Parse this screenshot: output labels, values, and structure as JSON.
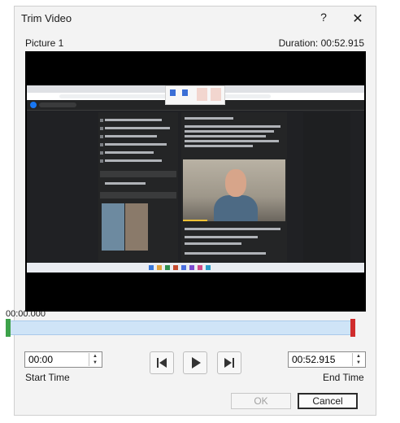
{
  "window": {
    "title": "Trim Video",
    "help_label": "?",
    "close_label": "✕"
  },
  "media": {
    "name": "Picture 1",
    "duration_label": "Duration: 00:52.915"
  },
  "trim": {
    "current_time": "00:00.000",
    "start_handle_color": "#3da24a",
    "end_handle_color": "#d02c2c"
  },
  "start_time": {
    "value": "00:00",
    "label": "Start Time"
  },
  "end_time": {
    "value": "00:52.915",
    "label": "End Time"
  },
  "playback": {
    "previous_frame": "previous-frame-icon",
    "play": "play-icon",
    "next_frame": "next-frame-icon"
  },
  "buttons": {
    "ok": "OK",
    "cancel": "Cancel"
  }
}
